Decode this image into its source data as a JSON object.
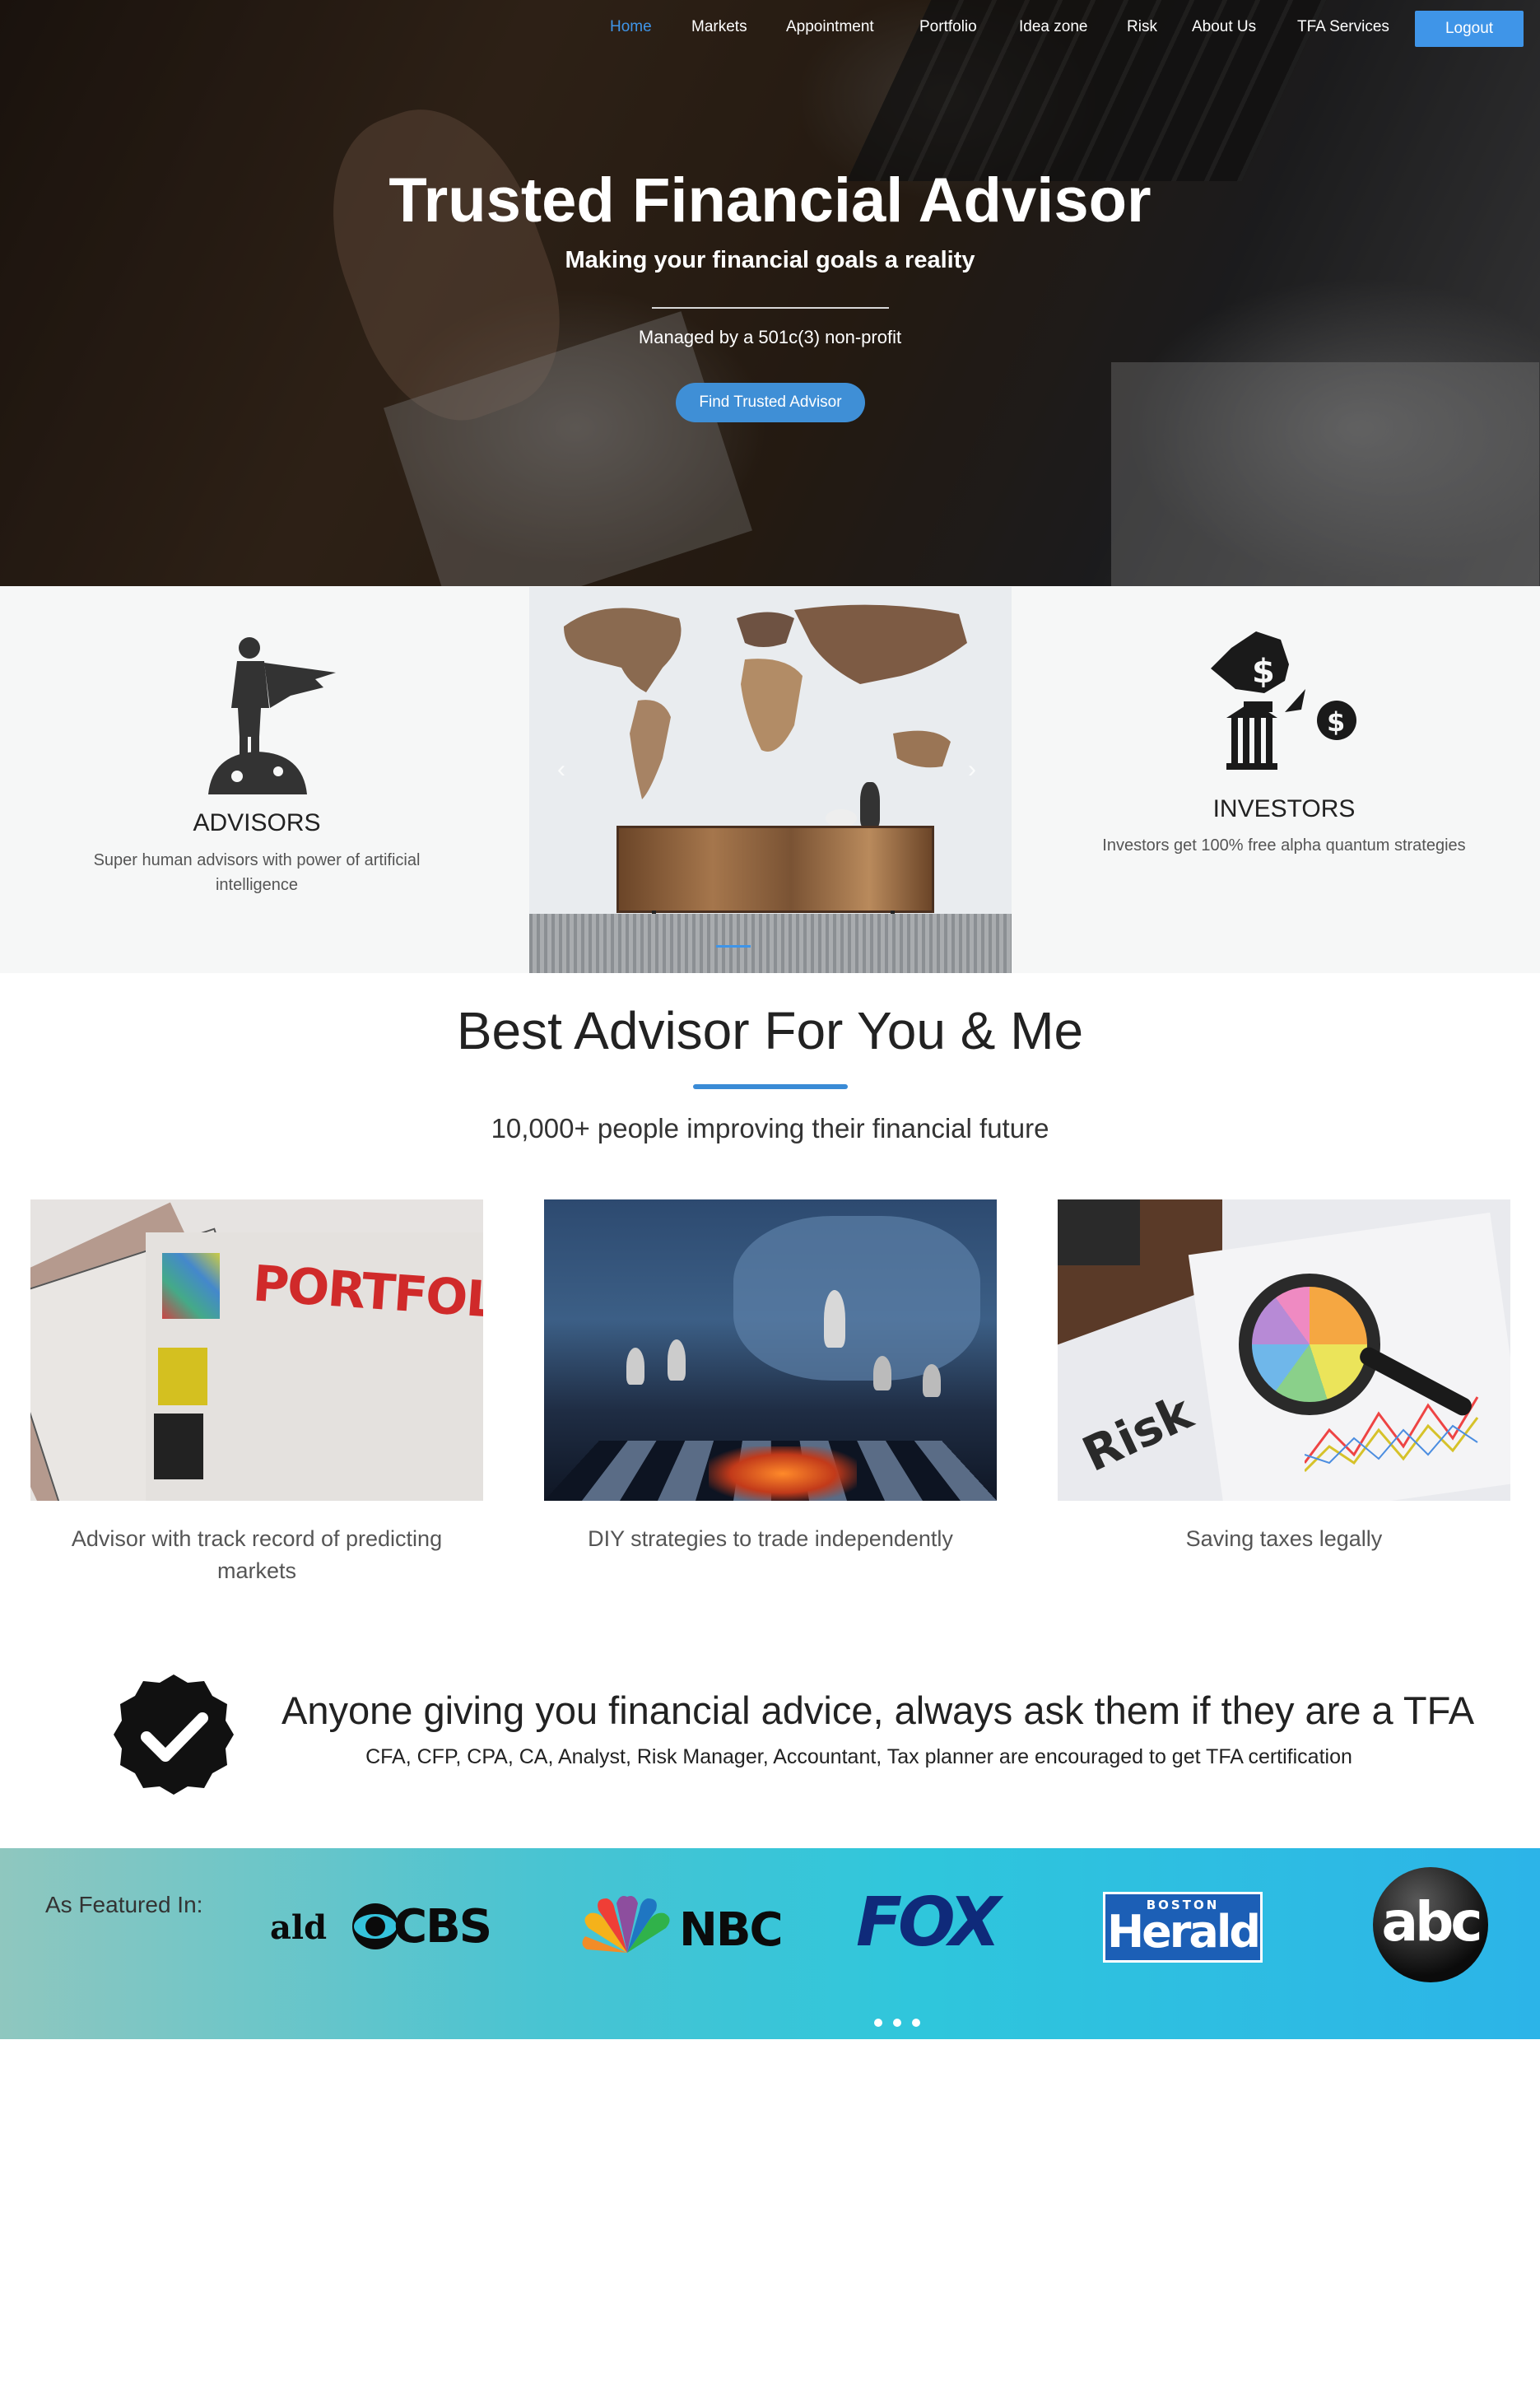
{
  "nav": {
    "items": [
      "Home",
      "Markets",
      "Appointment",
      "Portfolio",
      "Idea zone",
      "Risk",
      "About Us",
      "TFA Services"
    ],
    "active": "Home",
    "logout": "Logout"
  },
  "hero": {
    "title": "Trusted Financial Advisor",
    "subtitle": "Making your financial goals a reality",
    "managed": "Managed by a 501c(3) non-profit",
    "cta": "Find Trusted Advisor"
  },
  "features": {
    "advisors": {
      "title": "ADVISORS",
      "desc": "Super human advisors with power of artificial intelligence"
    },
    "investors": {
      "title": "INVESTORS",
      "desc": "Investors get 100% free alpha quantum strategies"
    },
    "carousel": {
      "prev": "‹",
      "next": "›"
    }
  },
  "best": {
    "title": "Best Advisor For You & Me",
    "subtitle": "10,000+ people improving their financial future",
    "cards": [
      {
        "image_label": "PORTFOLIO",
        "caption": "Advisor with track record of predicting markets"
      },
      {
        "image_label": "",
        "caption": "DIY strategies to trade independently"
      },
      {
        "image_label": "Risk",
        "caption": "Saving taxes legally"
      }
    ]
  },
  "tfa": {
    "title": "Anyone giving you financial advice, always ask them if they are a TFA",
    "subtitle": "CFA, CFP, CPA, CA, Analyst, Risk Manager, Accountant, Tax planner are encouraged to get TFA certification"
  },
  "featured": {
    "label": "As Featured In:",
    "logos": [
      "ald",
      "CBS",
      "NBC",
      "FOX",
      "BOSTON",
      "Herald",
      "abc"
    ]
  },
  "colors": {
    "accent": "#3f95e8",
    "nav_text": "#ffffff",
    "featured_start": "#8fc7bf",
    "featured_end": "#2cb4e8"
  }
}
